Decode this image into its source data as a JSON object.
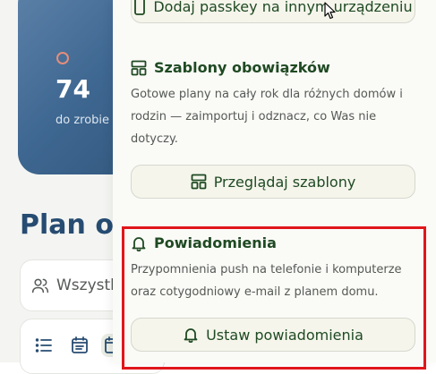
{
  "background": {
    "stat_value": "74",
    "stat_label": "do zrobie",
    "plan_title": "Plan ob",
    "filter_label": "Wszystk"
  },
  "panel": {
    "passkey_button": "Dodaj passkey na innym urządzeniu",
    "templates": {
      "title": "Szablony obowiązków",
      "description": "Gotowe plany na cały rok dla różnych domów i rodzin — zaimportuj i odznacz, co Was nie dotyczy.",
      "button": "Przeglądaj szablony"
    },
    "notifications": {
      "title": "Powiadomienia",
      "description": "Przypomnienia push na telefonie i komputerze oraz cotygodniowy e-mail z planem domu.",
      "button": "Ustaw powiadomienia"
    }
  },
  "colors": {
    "accent_green": "#1f4a22",
    "card_blue": "#3e6791",
    "highlight_red": "#e0161b"
  }
}
